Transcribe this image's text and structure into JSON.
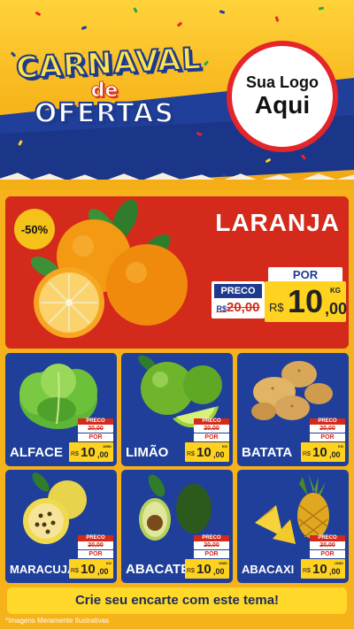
{
  "header": {
    "title_line1": "CARNAVAL",
    "title_line2": "de",
    "title_line3": "OFERTAS",
    "logo_line1": "Sua Logo",
    "logo_line2": "Aqui"
  },
  "featured": {
    "name": "LARANJA",
    "discount": "-50%",
    "preco_label": "PRECO",
    "old_price_currency": "R$",
    "old_price": "20,00",
    "por_label": "POR",
    "currency": "R$",
    "price_int": "10",
    "price_dec": ",00",
    "unit": "KG"
  },
  "products": [
    {
      "name": "ALFACE",
      "preco_label": "PRECO",
      "old_price": "20,00",
      "por_label": "POR",
      "currency": "R$",
      "price_int": "10",
      "price_dec": ",00",
      "unit": "UNID"
    },
    {
      "name": "LIMÃO",
      "preco_label": "PRECO",
      "old_price": "20,00",
      "por_label": "POR",
      "currency": "R$",
      "price_int": "10",
      "price_dec": ",00",
      "unit": "KG"
    },
    {
      "name": "BATATA",
      "preco_label": "PRECO",
      "old_price": "20,00",
      "por_label": "POR",
      "currency": "R$",
      "price_int": "10",
      "price_dec": ",00",
      "unit": "KG"
    },
    {
      "name": "MARACUJÁ",
      "preco_label": "PRECO",
      "old_price": "20,00",
      "por_label": "POR",
      "currency": "R$",
      "price_int": "10",
      "price_dec": ",00",
      "unit": "KG"
    },
    {
      "name": "ABACATE",
      "preco_label": "PRECO",
      "old_price": "20,00",
      "por_label": "POR",
      "currency": "R$",
      "price_int": "10",
      "price_dec": ",00",
      "unit": "UNID"
    },
    {
      "name": "ABACAXI",
      "preco_label": "PRECO",
      "old_price": "20,00",
      "por_label": "POR",
      "currency": "R$",
      "price_int": "10",
      "price_dec": ",00",
      "unit": "UNID"
    }
  ],
  "footer": {
    "cta": "Crie seu encarte com este tema!",
    "disclaimer": "*Imagens Meramente Ilustrativas"
  },
  "colors": {
    "background": "#f6b21a",
    "blue": "#1f3f9a",
    "red": "#d42a1c",
    "yellow": "#ffd21f"
  }
}
